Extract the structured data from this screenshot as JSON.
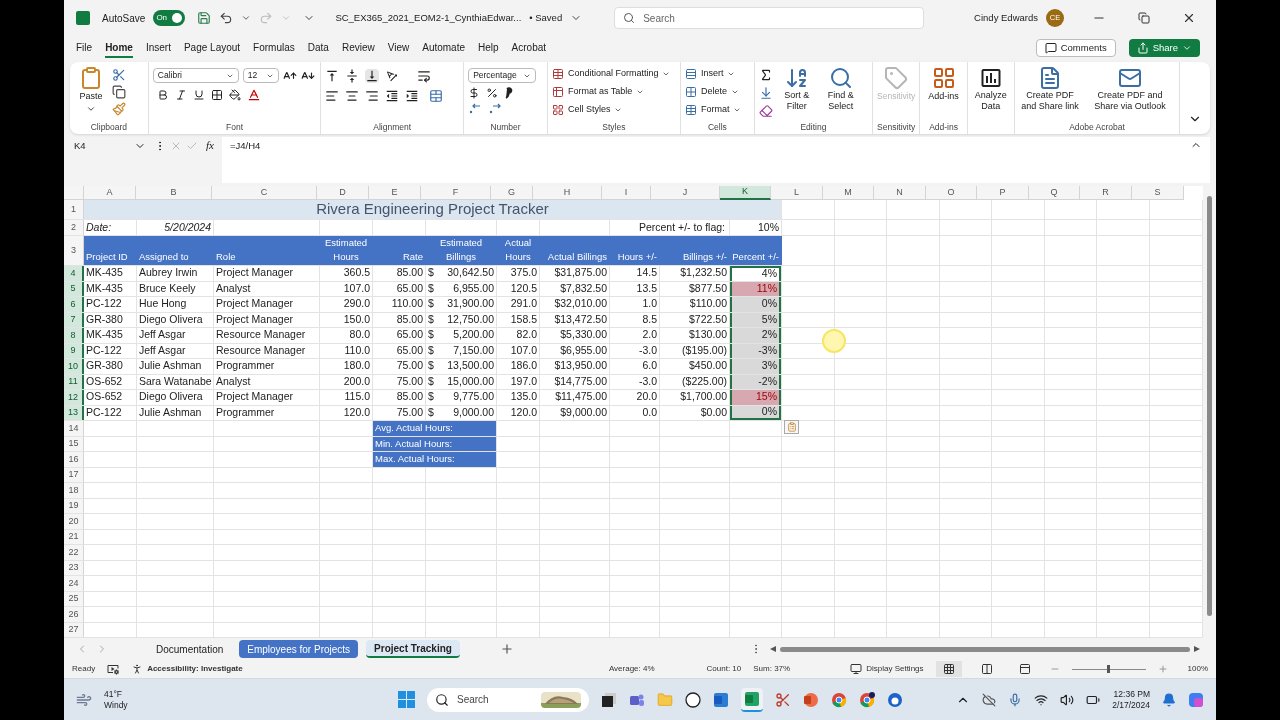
{
  "title_bar": {
    "autosave": {
      "label": "AutoSave",
      "on": true,
      "state_label": "On"
    },
    "file_name": "SC_EX365_2021_EOM2-1_CynthiaEdwar...",
    "save_status": "• Saved",
    "search_placeholder": "Search",
    "user_name": "Cindy Edwards",
    "user_initials": "CE"
  },
  "menu_tabs": [
    {
      "label": "File",
      "selected": false
    },
    {
      "label": "Home",
      "selected": true
    },
    {
      "label": "Insert",
      "selected": false
    },
    {
      "label": "Page Layout",
      "selected": false
    },
    {
      "label": "Formulas",
      "selected": false
    },
    {
      "label": "Data",
      "selected": false
    },
    {
      "label": "Review",
      "selected": false
    },
    {
      "label": "View",
      "selected": false
    },
    {
      "label": "Automate",
      "selected": false
    },
    {
      "label": "Help",
      "selected": false
    },
    {
      "label": "Acrobat",
      "selected": false
    }
  ],
  "comments_button": "Comments",
  "share_button": "Share",
  "ribbon": {
    "clipboard": {
      "label": "Clipboard",
      "paste": "Paste"
    },
    "font": {
      "label": "Font",
      "font_name": "Calibri",
      "font_size": "12"
    },
    "alignment": {
      "label": "Alignment"
    },
    "number": {
      "label": "Number",
      "format": "Percentage"
    },
    "styles": {
      "label": "Styles",
      "buttons": [
        "Conditional Formatting",
        "Format as Table",
        "Cell Styles"
      ]
    },
    "cells": {
      "label": "Cells",
      "buttons": [
        "Insert",
        "Delete",
        "Format"
      ]
    },
    "editing": {
      "label": "Editing",
      "buttons": [
        "Sort & Filter",
        "Find & Select"
      ]
    },
    "sensitivity": {
      "label": "Sensitivity",
      "button": "Sensitivity",
      "disabled": true
    },
    "addins": {
      "label": "Add-ins",
      "button": "Add-ins"
    },
    "analyze": {
      "button": "Analyze Data"
    },
    "acrobat": {
      "label": "Adobe Acrobat",
      "buttons": [
        "Create PDF and Share link",
        "Create PDF and Share via Outlook"
      ]
    }
  },
  "formula_bar": {
    "name_box": "K4",
    "function_label": "fx",
    "formula": "=J4/H4"
  },
  "sheet": {
    "columns": [
      {
        "label": "A",
        "selected": false
      },
      {
        "label": "B",
        "selected": false
      },
      {
        "label": "C",
        "selected": false
      },
      {
        "label": "D",
        "selected": false
      },
      {
        "label": "E",
        "selected": false
      },
      {
        "label": "F",
        "selected": false
      },
      {
        "label": "G",
        "selected": false
      },
      {
        "label": "H",
        "selected": false
      },
      {
        "label": "I",
        "selected": false
      },
      {
        "label": "J",
        "selected": false
      },
      {
        "label": "K",
        "selected": true
      },
      {
        "label": "L",
        "selected": false
      },
      {
        "label": "M",
        "selected": false
      },
      {
        "label": "N",
        "selected": false
      },
      {
        "label": "O",
        "selected": false
      },
      {
        "label": "P",
        "selected": false
      },
      {
        "label": "Q",
        "selected": false
      },
      {
        "label": "R",
        "selected": false
      },
      {
        "label": "S",
        "selected": false
      }
    ],
    "row_headers": [
      {
        "label": "1",
        "selected": false
      },
      {
        "label": "2",
        "selected": false
      },
      {
        "label": "3",
        "selected": false
      },
      {
        "label": "4",
        "selected": true
      },
      {
        "label": "5",
        "selected": true
      },
      {
        "label": "6",
        "selected": true
      },
      {
        "label": "7",
        "selected": true
      },
      {
        "label": "8",
        "selected": true
      },
      {
        "label": "9",
        "selected": true
      },
      {
        "label": "10",
        "selected": true
      },
      {
        "label": "11",
        "selected": true
      },
      {
        "label": "12",
        "selected": true
      },
      {
        "label": "13",
        "selected": true
      },
      {
        "label": "14",
        "selected": false
      },
      {
        "label": "15",
        "selected": false
      },
      {
        "label": "16",
        "selected": false
      },
      {
        "label": "17",
        "selected": false
      },
      {
        "label": "18",
        "selected": false
      },
      {
        "label": "19",
        "selected": false
      },
      {
        "label": "20",
        "selected": false
      },
      {
        "label": "21",
        "selected": false
      },
      {
        "label": "22",
        "selected": false
      },
      {
        "label": "23",
        "selected": false
      },
      {
        "label": "24",
        "selected": false
      },
      {
        "label": "25",
        "selected": false
      },
      {
        "label": "26",
        "selected": false
      },
      {
        "label": "27",
        "selected": false
      }
    ],
    "title": "Rivera Engineering Project Tracker",
    "date_label": "Date:",
    "date_value": "5/20/2024",
    "flag_label": "Percent +/- to flag:",
    "flag_value": "10%",
    "headers": [
      "Project ID",
      "Assigned to",
      "Role",
      "Estimated Hours",
      "Rate",
      "Estimated Billings",
      "Actual Hours",
      "Actual Billings",
      "Hours +/-",
      "Billings +/-",
      "Percent +/-"
    ],
    "rows": [
      {
        "project_id": "MK-435",
        "assigned_to": "Aubrey Irwin",
        "role": "Project Manager",
        "est_hours": "360.5",
        "rate": "85.00",
        "currency": "$",
        "est_billings": "30,642.50",
        "actual_hours": "375.0",
        "actual_billings": "$31,875.00",
        "hours_diff": "14.5",
        "billings_diff": "$1,232.50",
        "percent_diff": "4%",
        "flagged": false,
        "active": true,
        "selected": true
      },
      {
        "project_id": "MK-435",
        "assigned_to": "Bruce Keely",
        "role": "Analyst",
        "est_hours": "107.0",
        "rate": "65.00",
        "currency": "$",
        "est_billings": "6,955.00",
        "actual_hours": "120.5",
        "actual_billings": "$7,832.50",
        "hours_diff": "13.5",
        "billings_diff": "$877.50",
        "percent_diff": "11%",
        "flagged": true,
        "active": false,
        "selected": true
      },
      {
        "project_id": "PC-122",
        "assigned_to": "Hue Hong",
        "role": "Project Manager",
        "est_hours": "290.0",
        "rate": "110.00",
        "currency": "$",
        "est_billings": "31,900.00",
        "actual_hours": "291.0",
        "actual_billings": "$32,010.00",
        "hours_diff": "1.0",
        "billings_diff": "$110.00",
        "percent_diff": "0%",
        "flagged": false,
        "active": false,
        "selected": true
      },
      {
        "project_id": "GR-380",
        "assigned_to": "Diego Olivera",
        "role": "Project Manager",
        "est_hours": "150.0",
        "rate": "85.00",
        "currency": "$",
        "est_billings": "12,750.00",
        "actual_hours": "158.5",
        "actual_billings": "$13,472.50",
        "hours_diff": "8.5",
        "billings_diff": "$722.50",
        "percent_diff": "5%",
        "flagged": false,
        "active": false,
        "selected": true
      },
      {
        "project_id": "MK-435",
        "assigned_to": "Jeff Asgar",
        "role": "Resource Manager",
        "est_hours": "80.0",
        "rate": "65.00",
        "currency": "$",
        "est_billings": "5,200.00",
        "actual_hours": "82.0",
        "actual_billings": "$5,330.00",
        "hours_diff": "2.0",
        "billings_diff": "$130.00",
        "percent_diff": "2%",
        "flagged": false,
        "active": false,
        "selected": true
      },
      {
        "project_id": "PC-122",
        "assigned_to": "Jeff Asgar",
        "role": "Resource Manager",
        "est_hours": "110.0",
        "rate": "65.00",
        "currency": "$",
        "est_billings": "7,150.00",
        "actual_hours": "107.0",
        "actual_billings": "$6,955.00",
        "hours_diff": "-3.0",
        "billings_diff": "($195.00)",
        "percent_diff": "-3%",
        "flagged": false,
        "active": false,
        "selected": true
      },
      {
        "project_id": "GR-380",
        "assigned_to": "Julie Ashman",
        "role": "Programmer",
        "est_hours": "180.0",
        "rate": "75.00",
        "currency": "$",
        "est_billings": "13,500.00",
        "actual_hours": "186.0",
        "actual_billings": "$13,950.00",
        "hours_diff": "6.0",
        "billings_diff": "$450.00",
        "percent_diff": "3%",
        "flagged": false,
        "active": false,
        "selected": true
      },
      {
        "project_id": "OS-652",
        "assigned_to": "Sara Watanabe",
        "role": "Analyst",
        "est_hours": "200.0",
        "rate": "75.00",
        "currency": "$",
        "est_billings": "15,000.00",
        "actual_hours": "197.0",
        "actual_billings": "$14,775.00",
        "hours_diff": "-3.0",
        "billings_diff": "($225.00)",
        "percent_diff": "-2%",
        "flagged": false,
        "active": false,
        "selected": true
      },
      {
        "project_id": "OS-652",
        "assigned_to": "Diego Olivera",
        "role": "Project Manager",
        "est_hours": "115.0",
        "rate": "85.00",
        "currency": "$",
        "est_billings": "9,775.00",
        "actual_hours": "135.0",
        "actual_billings": "$11,475.00",
        "hours_diff": "20.0",
        "billings_diff": "$1,700.00",
        "percent_diff": "15%",
        "flagged": true,
        "active": false,
        "selected": true
      },
      {
        "project_id": "PC-122",
        "assigned_to": "Julie Ashman",
        "role": "Programmer",
        "est_hours": "120.0",
        "rate": "75.00",
        "currency": "$",
        "est_billings": "9,000.00",
        "actual_hours": "120.0",
        "actual_billings": "$9,000.00",
        "hours_diff": "0.0",
        "billings_diff": "$0.00",
        "percent_diff": "0%",
        "flagged": false,
        "active": false,
        "selected": true
      }
    ],
    "summary_labels": [
      "Avg. Actual Hours:",
      "Min. Actual Hours:",
      "Max. Actual Hours:"
    ]
  },
  "sheet_tabs": [
    {
      "label": "Documentation",
      "selected": false,
      "color": "#f3f3f3"
    },
    {
      "label": "Employees for Projects",
      "selected": false,
      "color": "#4472c4"
    },
    {
      "label": "Project Tracking",
      "selected": true,
      "color": "#dde8f5"
    }
  ],
  "status_bar": {
    "mode": "Ready",
    "accessibility": "Accessibility: Investigate",
    "average": "Average: 4%",
    "count": "Count: 10",
    "sum": "Sum: 37%",
    "display_settings": "Display Settings",
    "views": [
      {
        "kind": "normal",
        "selected": true
      },
      {
        "kind": "page_layout",
        "selected": false
      },
      {
        "kind": "page_break",
        "selected": false
      }
    ],
    "zoom_slider": {
      "level": 0.5
    },
    "zoom": "100%"
  },
  "taskbar": {
    "temperature": "41°F",
    "weather": "Windy",
    "search_placeholder": "Search",
    "time": "12:36 PM",
    "date": "2/17/2024"
  }
}
